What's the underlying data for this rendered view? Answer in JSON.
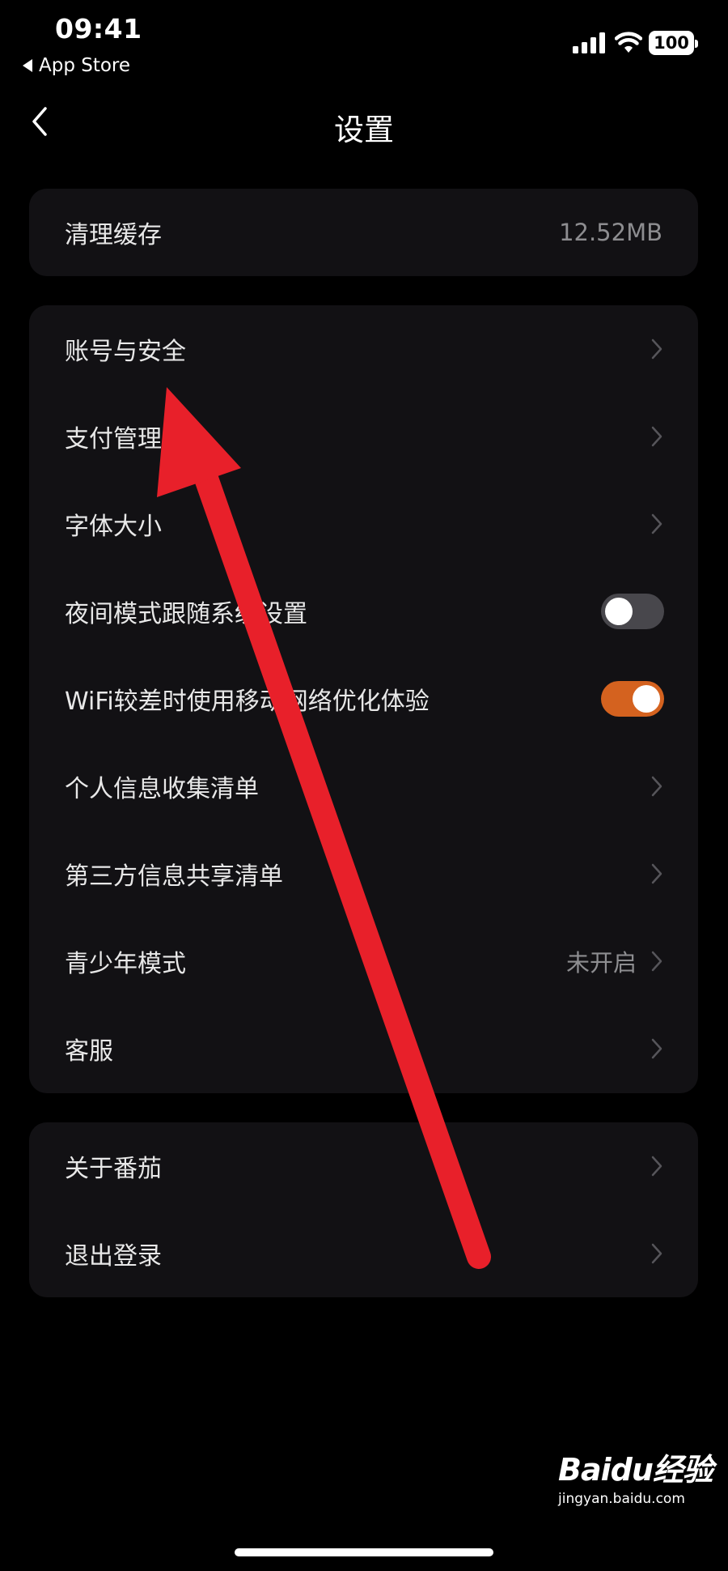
{
  "status_bar": {
    "time": "09:41",
    "back_app": "App Store",
    "battery": "100"
  },
  "header": {
    "title": "设置"
  },
  "cache_card": {
    "label": "清理缓存",
    "value": "12.52MB"
  },
  "main_card": {
    "items": [
      {
        "label": "账号与安全"
      },
      {
        "label": "支付管理"
      },
      {
        "label": "字体大小"
      },
      {
        "label": "夜间模式跟随系统设置",
        "toggle": "off"
      },
      {
        "label": "WiFi较差时使用移动网络优化体验",
        "toggle": "on"
      },
      {
        "label": "个人信息收集清单"
      },
      {
        "label": "第三方信息共享清单"
      },
      {
        "label": "青少年模式",
        "value": "未开启"
      },
      {
        "label": "客服"
      }
    ]
  },
  "bottom_card": {
    "items": [
      {
        "label": "关于番茄"
      },
      {
        "label": "退出登录"
      }
    ]
  },
  "watermark": {
    "logo": "Baidu经验",
    "url": "jingyan.baidu.com"
  },
  "colors": {
    "background": "#000000",
    "card": "#121114",
    "toggle_on": "#d4621f",
    "toggle_off": "#48474c",
    "annotation_arrow": "#e8202a"
  },
  "icons": [
    "signal-icon",
    "wifi-icon",
    "back-chevron-icon",
    "chevron-right-icon"
  ]
}
